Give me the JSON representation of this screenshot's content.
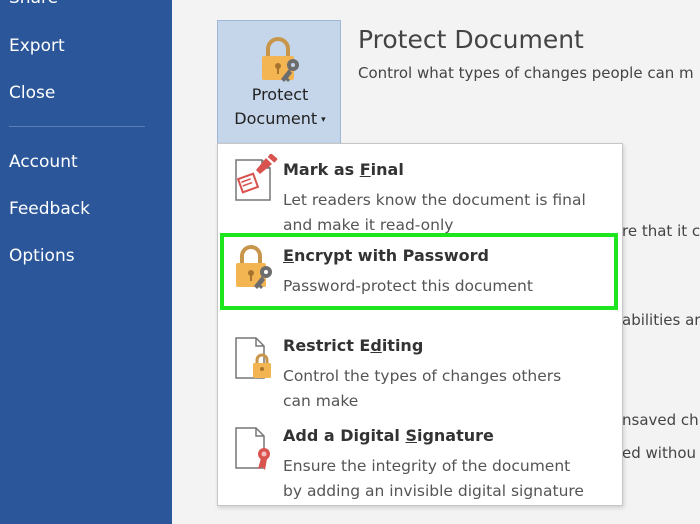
{
  "nav": {
    "share": "Share",
    "export": "Export",
    "close": "Close",
    "account": "Account",
    "feedback": "Feedback",
    "options": "Options"
  },
  "protect_button": {
    "line1": "Protect",
    "line2": "Document",
    "caret": "▾"
  },
  "header": {
    "title": "Protect Document",
    "subtitle": "Control what types of changes people can m"
  },
  "background_text": {
    "line1": "re that it c",
    "line2": "abilities ar",
    "line3": "nsaved ch",
    "line4": "ed withou"
  },
  "menu": {
    "items": [
      {
        "title_pre": "Mark as ",
        "title_u": "F",
        "title_post": "inal",
        "desc1": "Let readers know the document is final",
        "desc2": "and make it read-only"
      },
      {
        "title_pre": "",
        "title_u": "E",
        "title_post": "ncrypt with Password",
        "desc1": "Password-protect this document",
        "desc2": ""
      },
      {
        "title_pre": "Restrict E",
        "title_u": "d",
        "title_post": "iting",
        "desc1": "Control the types of changes others",
        "desc2": "can make"
      },
      {
        "title_pre": "Add a Digital ",
        "title_u": "S",
        "title_post": "ignature",
        "desc1": "Ensure the integrity of the document",
        "desc2": "by adding an invisible digital signature"
      }
    ]
  },
  "colors": {
    "nav_bg": "#2b579a",
    "highlight": "#1ee61e",
    "lock": "#f2b552"
  }
}
